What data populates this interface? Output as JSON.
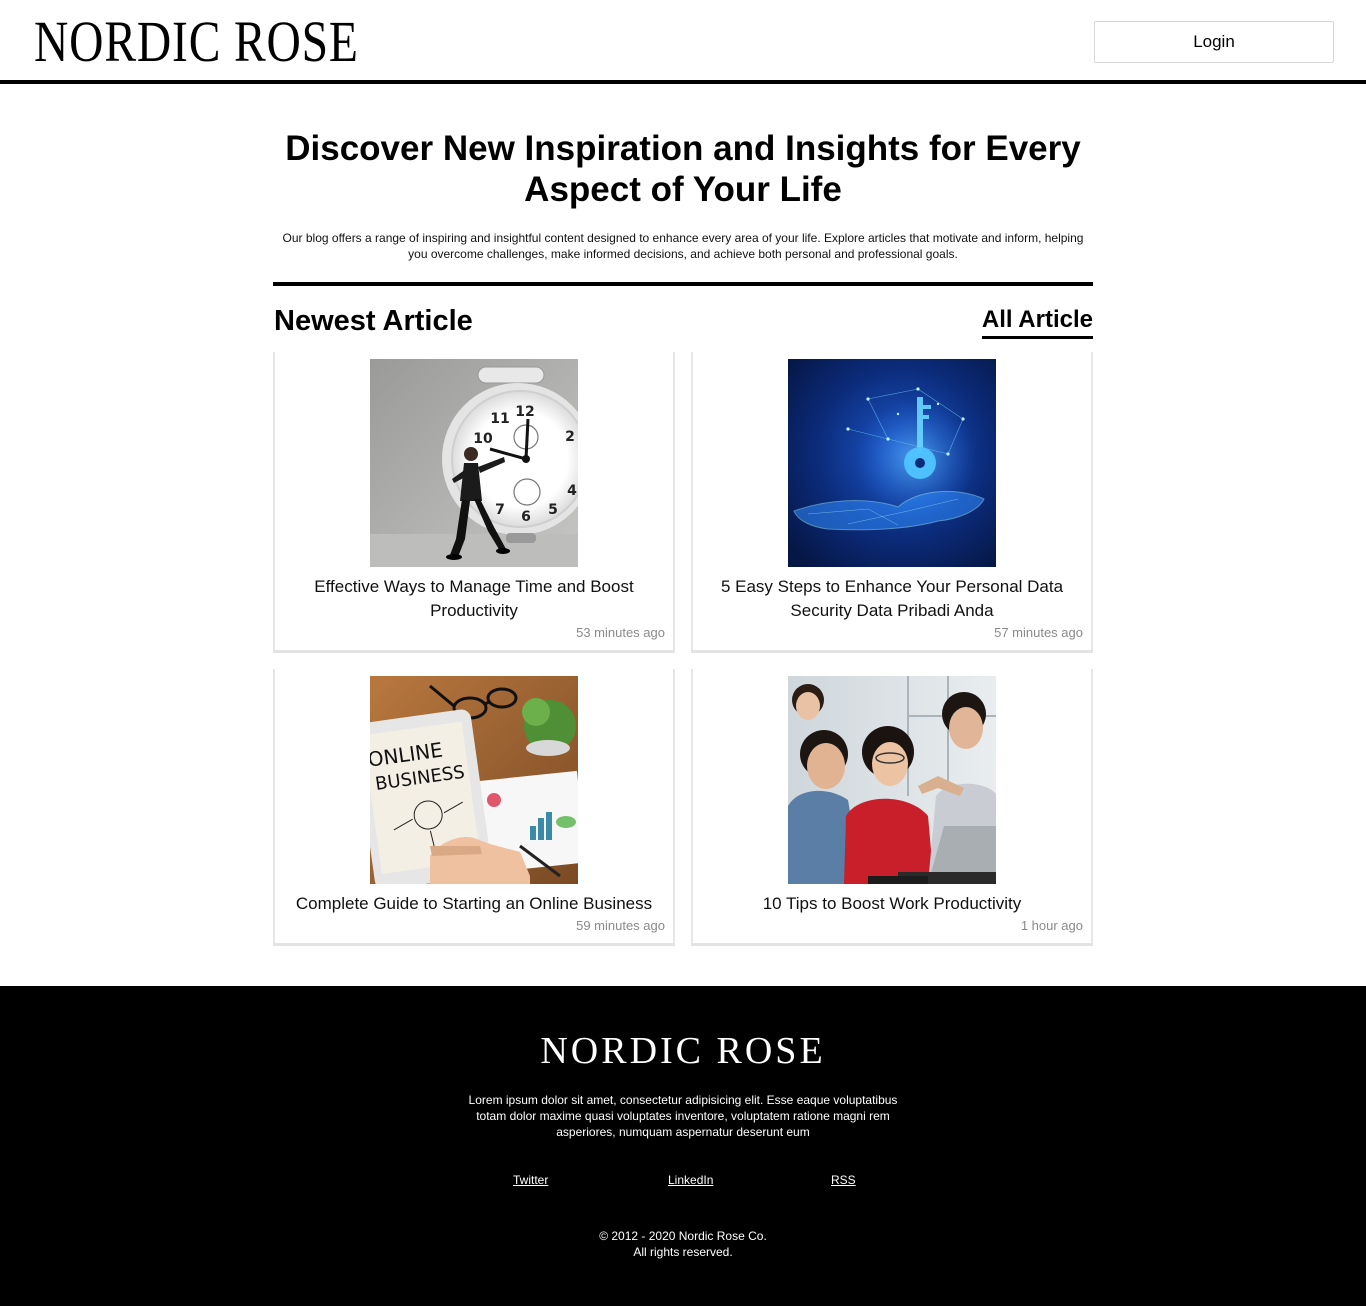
{
  "header": {
    "logo": "NORDIC ROSE",
    "login_label": "Login"
  },
  "hero": {
    "title": "Discover New Inspiration and Insights for Every Aspect of Your Life",
    "description": "Our blog offers a range of inspiring and insightful content designed to enhance every area of your life. Explore articles that motivate and inform, helping you overcome challenges, make informed decisions, and achieve both personal and professional goals."
  },
  "section": {
    "title": "Newest Article",
    "all_link": "All Article"
  },
  "articles": [
    {
      "title": "Effective Ways to Manage Time and Boost Productivity",
      "time": "53 minutes ago"
    },
    {
      "title": "5 Easy Steps to Enhance Your Personal Data Security Data Pribadi Anda",
      "time": "57 minutes ago"
    },
    {
      "title": "Complete Guide to Starting an Online Business",
      "time": "59 minutes ago",
      "image_text": [
        "ONLINE",
        "BUSINESS"
      ]
    },
    {
      "title": "10 Tips to Boost Work Productivity",
      "time": "1 hour ago"
    }
  ],
  "footer": {
    "logo": "NORDIC ROSE",
    "description": "Lorem ipsum dolor sit amet, consectetur adipisicing elit. Esse eaque voluptatibus totam dolor maxime quasi voluptates inventore, voluptatem ratione magni rem asperiores, numquam aspernatur deserunt eum",
    "links": [
      "Twitter",
      "LinkedIn",
      "RSS"
    ],
    "copyright": "© 2012 - 2020 Nordic Rose Co.",
    "rights": "All rights reserved."
  }
}
